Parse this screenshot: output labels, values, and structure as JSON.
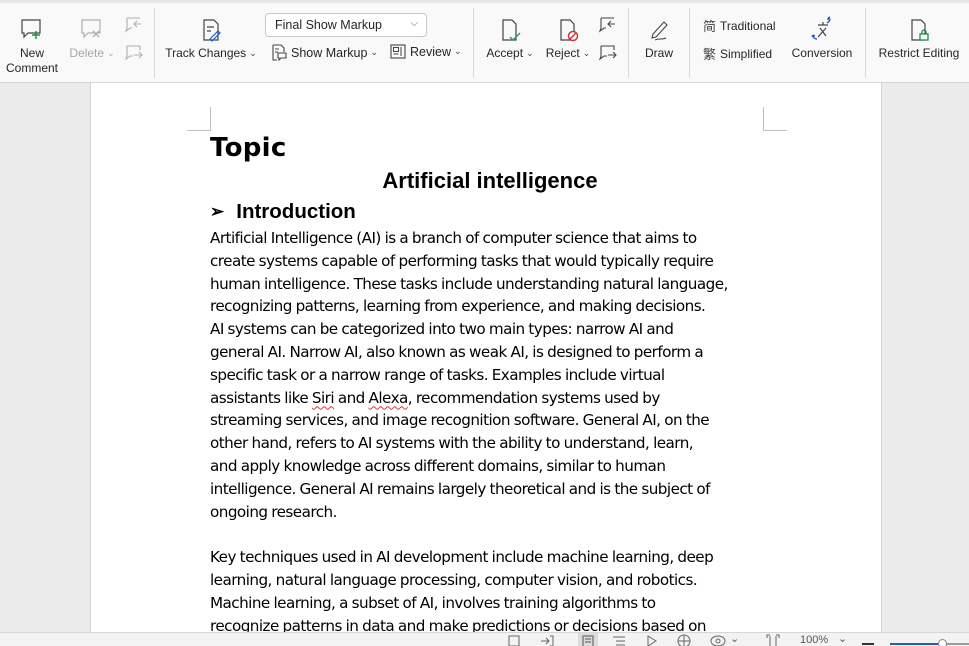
{
  "ribbon": {
    "comments": {
      "new_comment": "New\nComment",
      "new_label_1": "New",
      "new_label_2": "Comment",
      "delete": "Delete"
    },
    "tracking": {
      "track_changes": "Track Changes",
      "markup_view": "Final Show Markup",
      "show_markup": "Show Markup",
      "review": "Review"
    },
    "changes": {
      "accept": "Accept",
      "reject": "Reject"
    },
    "ink": {
      "draw": "Draw"
    },
    "chinese": {
      "traditional": "Traditional",
      "simplified": "Simplified",
      "conversion": "Conversion"
    },
    "protect": {
      "restrict_editing": "Restrict Editing"
    }
  },
  "document": {
    "topic": "Topic",
    "title": "Artificial intelligence",
    "heading": "Introduction",
    "paragraph1_lines": [
      "Artificial Intelligence (AI) is a branch of computer science that aims to",
      "create systems capable of performing tasks that would typically require",
      "human intelligence. These tasks include understanding natural language,",
      "recognizing patterns, learning from experience, and making decisions.",
      "AI systems can be categorized into two main types: narrow AI and",
      "general AI. Narrow AI, also known as weak AI, is designed to perform a",
      "specific task or a narrow range of tasks. Examples include virtual",
      "assistants like ",
      "Siri",
      " and ",
      "Alexa",
      ", recommendation systems used by",
      "streaming services, and image recognition software. General AI, on the",
      "other hand, refers to AI systems with the ability to understand, learn,",
      "and apply knowledge across different domains, similar to human",
      "intelligence. General AI remains largely theoretical and is the subject of",
      "ongoing research."
    ],
    "paragraph2_lines": [
      "Key techniques used in AI development include machine learning, deep",
      "learning, natural language processing, computer vision, and robotics.",
      "Machine learning, a subset of AI, involves training algorithms to",
      "recognize patterns in data and make predictions or decisions based on"
    ]
  },
  "statusbar": {
    "zoom_level": "100%",
    "zoom_fraction": 0.65
  },
  "colors": {
    "accent_blue": "#1f5fc8",
    "spell_error": "#e03131",
    "accept_green": "#2a9d6f",
    "reject_red": "#d13438"
  }
}
